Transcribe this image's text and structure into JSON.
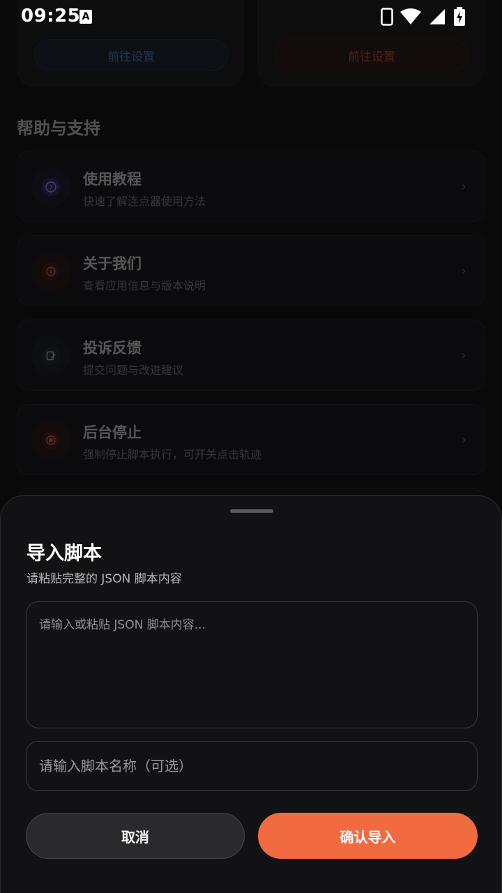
{
  "status_bar": {
    "time": "09:25",
    "notification_icon": "A"
  },
  "background": {
    "top_cards": [
      {
        "button_label": "前往设置",
        "accent": "#4a8ad8"
      },
      {
        "button_label": "前往设置",
        "accent": "#d5503a"
      }
    ],
    "section_title": "帮助与支持",
    "items": [
      {
        "title": "使用教程",
        "subtitle": "快速了解连点器使用方法",
        "icon": "question-icon",
        "icon_color": "#6a4ad0"
      },
      {
        "title": "关于我们",
        "subtitle": "查看应用信息与版本说明",
        "icon": "info-icon",
        "icon_color": "#c03a32"
      },
      {
        "title": "投诉反馈",
        "subtitle": "提交问题与改进建议",
        "icon": "feedback-edit-icon",
        "icon_color": "#7a8a9c"
      },
      {
        "title": "后台停止",
        "subtitle": "强制停止脚本执行，可开关点击轨迹",
        "icon": "stop-record-icon",
        "icon_color": "#d03a32"
      }
    ]
  },
  "sheet": {
    "title": "导入脚本",
    "subtitle": "请粘贴完整的 JSON 脚本内容",
    "textarea_placeholder": "请输入或粘贴 JSON 脚本内容...",
    "name_placeholder": "请输入脚本名称（可选）",
    "cancel_label": "取消",
    "confirm_label": "确认导入",
    "confirm_color": "#f26a3f"
  }
}
